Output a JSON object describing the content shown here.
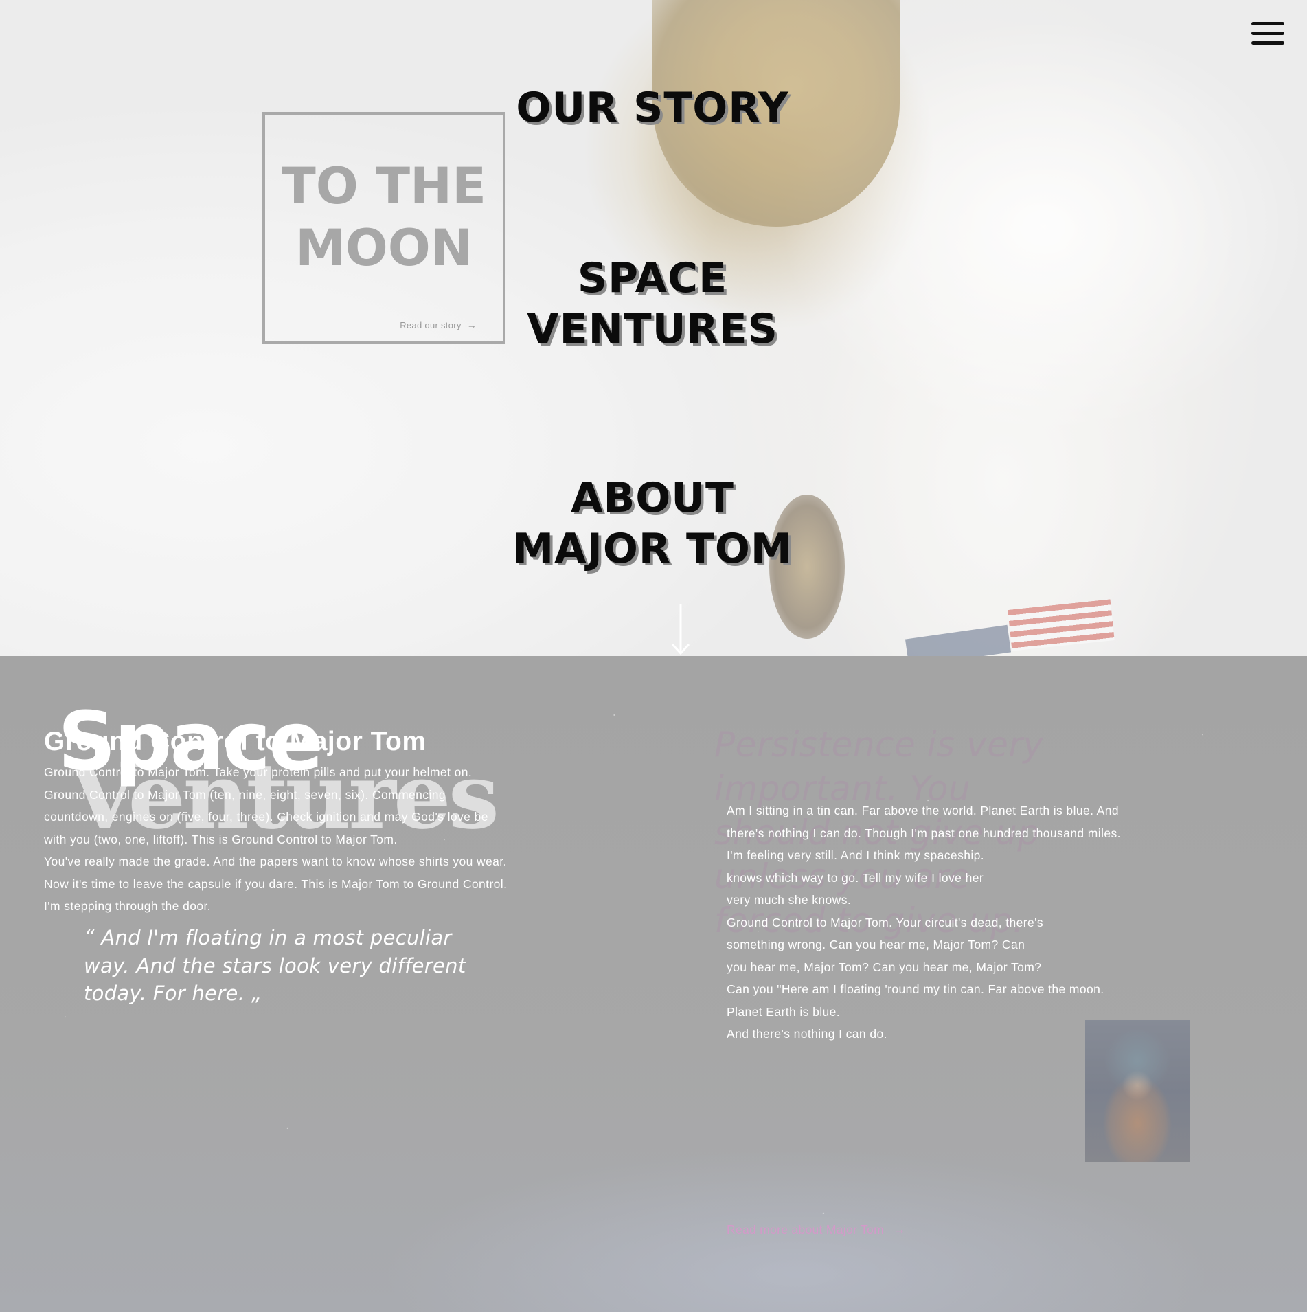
{
  "hero": {
    "menu_icon": "hamburger-menu-icon",
    "story_box": {
      "title_line1": "TO THE",
      "title_line2": "MOON",
      "link_label": "Read our story",
      "link_icon": "arrow-right-icon"
    },
    "nav": {
      "our_story": "OUR STORY",
      "space_ventures_line1": "SPACE",
      "space_ventures_line2": "VENTURES",
      "about_line1": "ABOUT",
      "about_line2": "MAJOR TOM"
    },
    "scroll_icon": "arrow-down-icon"
  },
  "content": {
    "logo_word1": "Space",
    "logo_word2": "Ventures",
    "heading": "Ground Control to Major Tom",
    "left_paragraph_1": "Ground Control to Major Tom. Take your protein pills and put your helmet on. Ground Control to Major Tom (ten, nine, eight, seven, six). Commencing countdown, engines on (five, four, three). Check ignition and may God's love be with you (two, one, liftoff). This is Ground Control to Major Tom.",
    "left_paragraph_2": "You've really made the grade. And the papers want to know whose shirts you wear. Now it's time to leave the capsule if you dare. This is Major Tom to Ground Control. I'm stepping through the door.",
    "quote_open": "“",
    "quote_text": "And I'm floating in a most peculiar way. And the stars look very different today. For here.",
    "quote_close": "„",
    "big_quote": "Persistence is very important. You should not give up unless you are forced to give up.",
    "right_lines": [
      "Am I sitting in a tin can. Far above the world. Planet Earth is blue. And",
      "there's nothing I can do. Though I'm past one hundred thousand miles.",
      "I'm feeling very still. And I think my spaceship.",
      "knows which way to go. Tell my wife I love her",
      "very much she knows.",
      "Ground Control to Major Tom. Your circuit's dead, there's",
      "something wrong. Can you hear me, Major Tom? Can",
      "you hear me, Major Tom? Can you hear me, Major Tom?",
      "Can you \"Here am I floating 'round my tin can. Far above the moon.",
      "Planet Earth is blue.",
      "And there's nothing I can do."
    ],
    "read_more": "Read more about Major Tom",
    "read_more_icon": "arrow-right-icon",
    "accent_color": "#d39ac9"
  }
}
